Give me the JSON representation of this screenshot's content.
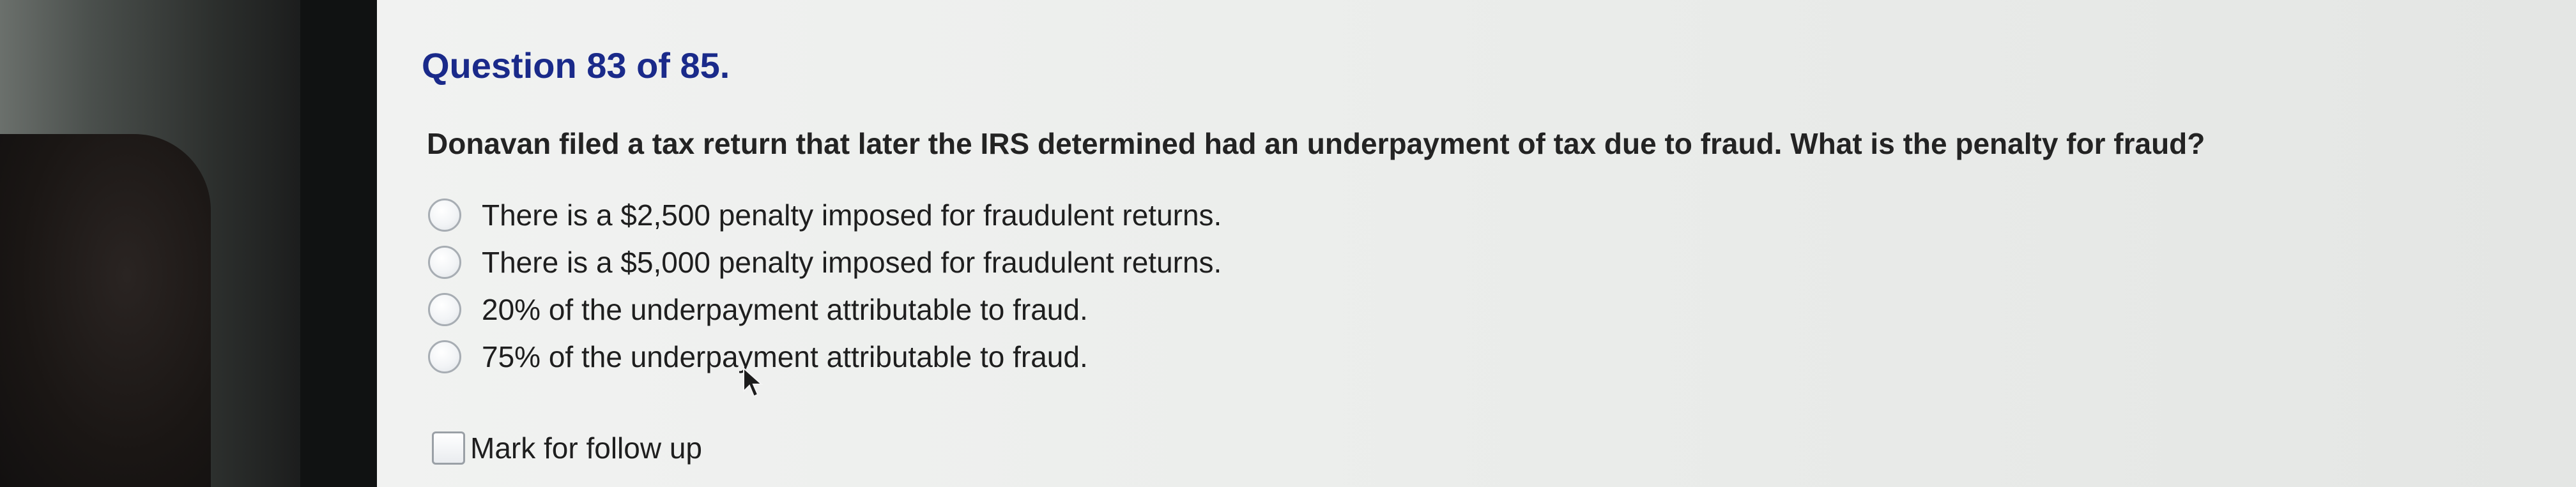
{
  "quiz": {
    "header": "Question 83 of 85.",
    "question": "Donavan filed a tax return that later the IRS determined had an underpayment of tax due to fraud. What is the penalty for fraud?",
    "options": [
      {
        "label": "There is a $2,500 penalty imposed for fraudulent returns.",
        "selected": false
      },
      {
        "label": "There is a $5,000 penalty imposed for fraudulent returns.",
        "selected": false
      },
      {
        "label": "20% of the underpayment attributable to fraud.",
        "selected": false
      },
      {
        "label": "75% of the underpayment attributable to fraud.",
        "selected": false
      }
    ],
    "follow_up_label": "Mark for follow up",
    "follow_up_checked": false
  },
  "colors": {
    "header": "#1a2a8a",
    "text": "#232323",
    "screen_bg": "#eceeec"
  },
  "icons": {
    "cursor": "mouse-pointer-icon"
  }
}
